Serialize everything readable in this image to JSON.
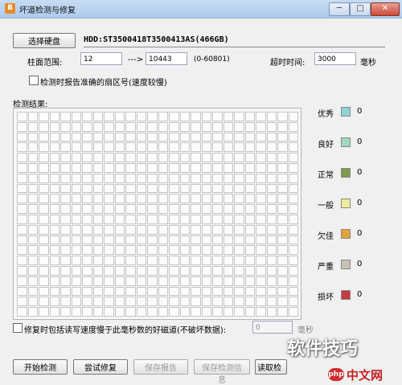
{
  "window": {
    "title": "坏道检测与修复",
    "icon_text": "B",
    "min_label": "─",
    "max_label": "□",
    "close_label": "✕"
  },
  "disk": {
    "select_button": "选择硬盘",
    "selected": "HDD:ST3500418T3500413AS(466GB)"
  },
  "cylinder": {
    "label": "柱面范围:",
    "start": "12",
    "arrow": "--->",
    "end": "10443",
    "range_hint": "(0-60801)"
  },
  "timeout": {
    "label": "超时时间:",
    "value": "3000",
    "unit": "毫秒"
  },
  "report_sector_option": {
    "label": "检测时报告准确的扇区号(速度较慢)",
    "checked": false
  },
  "results": {
    "label": "检测结果:"
  },
  "legend": [
    {
      "label": "优秀",
      "color": "#8fd3d6",
      "count": "0"
    },
    {
      "label": "良好",
      "color": "#9ed8c0",
      "count": "0"
    },
    {
      "label": "正常",
      "color": "#7d9b4a",
      "count": "0"
    },
    {
      "label": "一般",
      "color": "#ecec9a",
      "count": "0"
    },
    {
      "label": "欠佳",
      "color": "#e3a23b",
      "count": "0"
    },
    {
      "label": "严重",
      "color": "#c9c2b5",
      "count": "0"
    },
    {
      "label": "损坏",
      "color": "#c8393b",
      "count": "0"
    }
  ],
  "repair_option": {
    "label": "修复时包括读写速度慢于此毫秒数的好磁道(不破坏数据):",
    "value": "0",
    "unit": "毫秒",
    "checked": false
  },
  "buttons": {
    "start": "开始检测",
    "try_repair": "尝试修复",
    "save_report": "保存报告",
    "save_info": "保存检测信息",
    "read": "读取检"
  },
  "watermark": {
    "main": "软件技巧",
    "logo": "php",
    "site": "中文网"
  }
}
